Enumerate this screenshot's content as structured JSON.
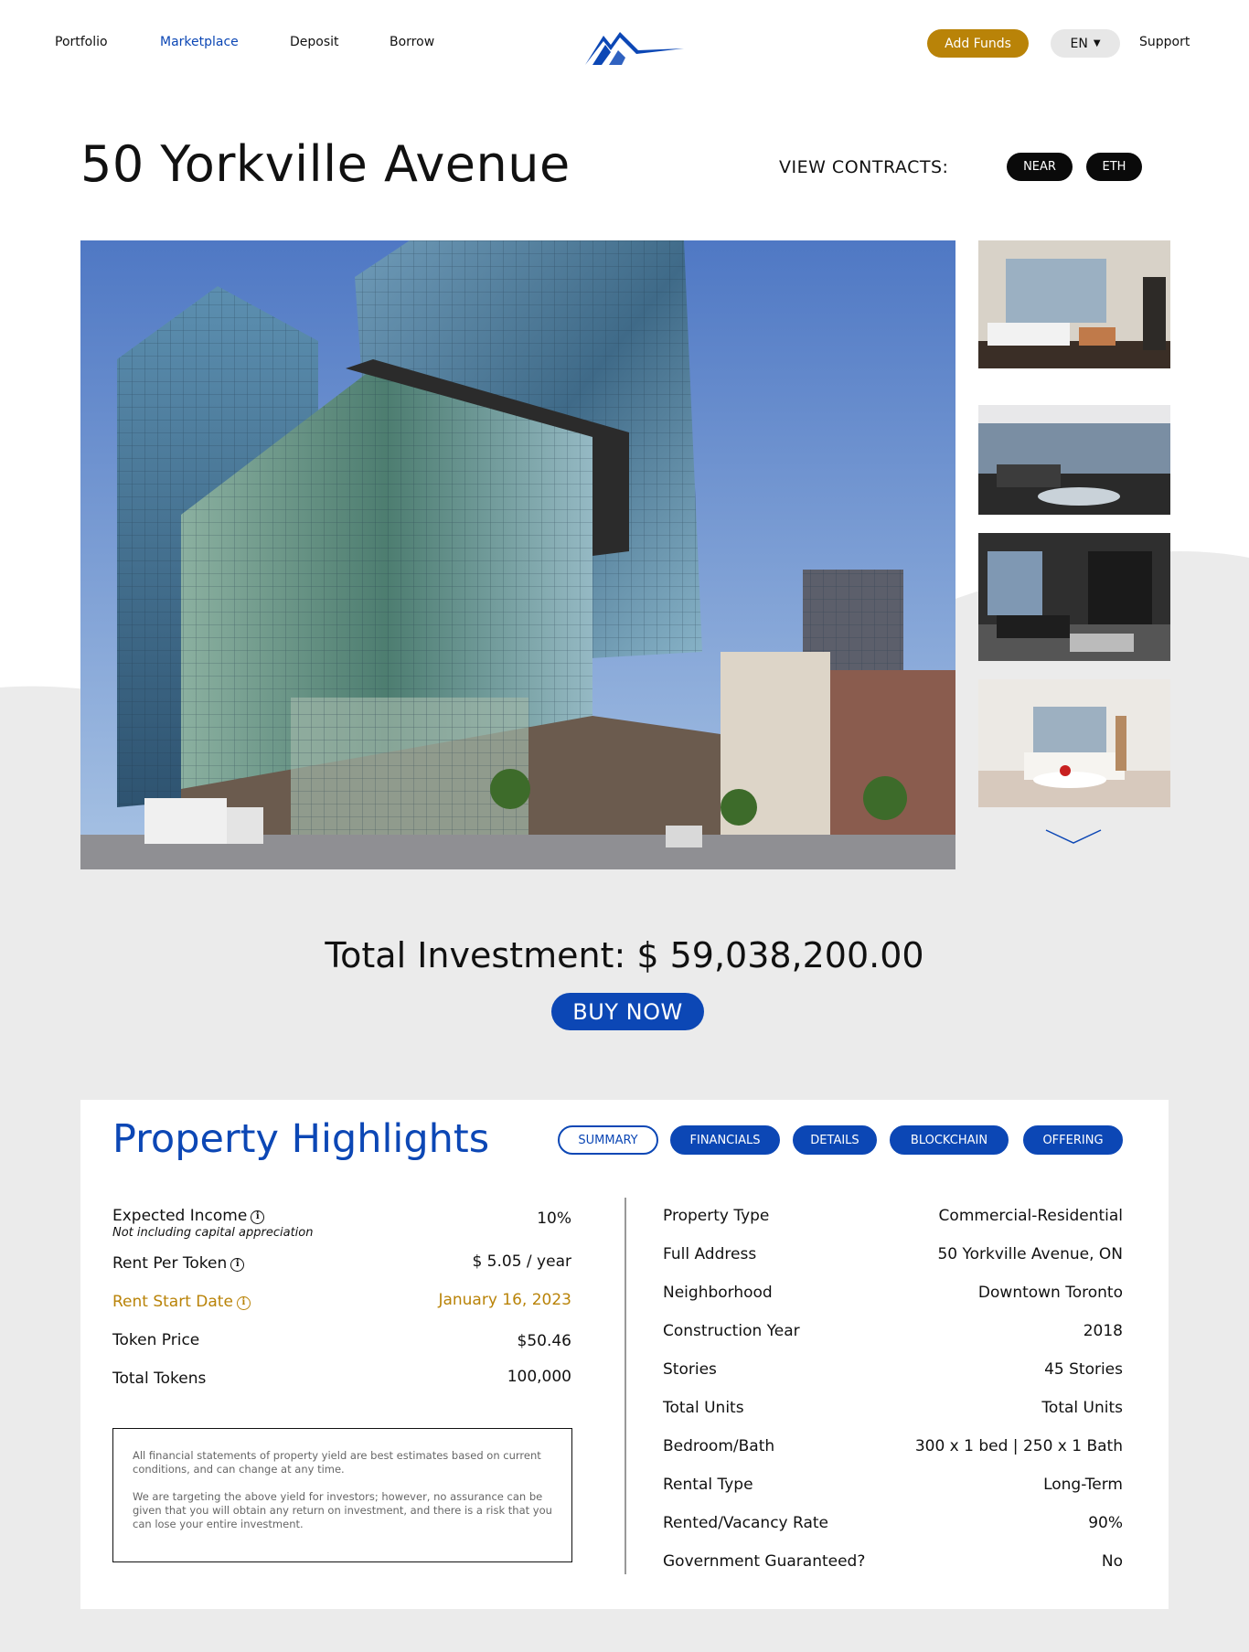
{
  "nav": {
    "links": [
      "Portfolio",
      "Marketplace",
      "Deposit",
      "Borrow"
    ],
    "active": "Marketplace",
    "add_funds": "Add Funds",
    "language": "EN",
    "support": "Support"
  },
  "property": {
    "title": "50 Yorkville Avenue",
    "view_contracts_label": "VIEW CONTRACTS:",
    "contracts": [
      "NEAR",
      "ETH"
    ]
  },
  "investment": {
    "total_label": "Total Investment: $ 59,038,200.00",
    "buy_label": "BUY NOW"
  },
  "highlights": {
    "title": "Property Highlights",
    "tabs": [
      "SUMMARY",
      "FINANCIALS",
      "DETAILS",
      "BLOCKCHAIN",
      "OFFERING"
    ],
    "active_tab": "SUMMARY",
    "financials": [
      {
        "label": "Expected Income",
        "value": "10%"
      },
      {
        "label": "Rent Per Token",
        "value": "$ 5.05 / year"
      },
      {
        "label": "Rent Start Date",
        "value": "January 16, 2023"
      },
      {
        "label": "Token Price",
        "value": "$50.46"
      },
      {
        "label": "Total Tokens",
        "value": "100,000"
      }
    ],
    "income_note": "Not including capital appreciation",
    "disclaimer": [
      "All financial statements of property yield are best estimates based on current conditions, and can change at any time.",
      "We are targeting the above yield for investors; however, no assurance can be given that you will obtain any return on investment, and there is a risk that you can lose your entire investment."
    ],
    "details": [
      {
        "label": "Property Type",
        "value": "Commercial-Residential"
      },
      {
        "label": "Full Address",
        "value": "50 Yorkville Avenue, ON"
      },
      {
        "label": "Neighborhood",
        "value": "Downtown Toronto"
      },
      {
        "label": "Construction Year",
        "value": "2018"
      },
      {
        "label": "Stories",
        "value": "45 Stories"
      },
      {
        "label": "Total Units",
        "value": "Total Units"
      },
      {
        "label": "Bedroom/Bath",
        "value": "300 x 1 bed | 250 x 1 Bath"
      },
      {
        "label": "Rental Type",
        "value": "Long-Term"
      },
      {
        "label": "Rented/Vacancy Rate",
        "value": "90%"
      },
      {
        "label": "Government Guaranteed?",
        "value": "No"
      }
    ]
  },
  "colors": {
    "brand_blue": "#0c47b5",
    "gold": "#b98308",
    "page_grey": "#ebebeb",
    "black_chip": "#0a0a0a"
  },
  "icons": [
    "mountain-logo-icon",
    "chevron-down-icon",
    "info-icon"
  ]
}
